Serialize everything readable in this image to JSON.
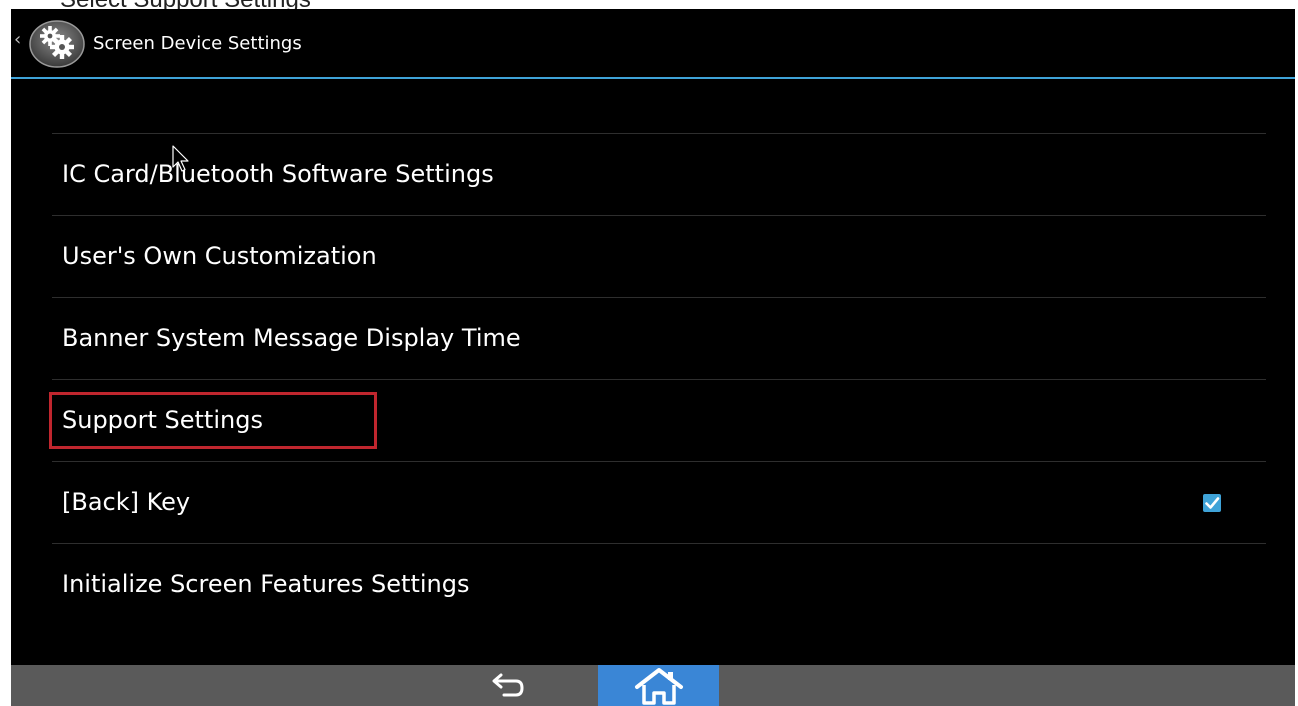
{
  "caption": {
    "text": "Select Support Settings"
  },
  "header": {
    "title": "Screen Device Settings",
    "back_chevron": "‹",
    "accent_color": "#3fa3d8",
    "icon": "gear-settings-icon"
  },
  "settings_list": {
    "items": [
      {
        "label": "IC Card/Bluetooth Software Settings",
        "checked": null
      },
      {
        "label": "User's Own Customization",
        "checked": null
      },
      {
        "label": "Banner System Message Display Time",
        "checked": null
      },
      {
        "label": "Support Settings",
        "checked": null,
        "highlighted": true
      },
      {
        "label": "[Back] Key",
        "checked": true
      },
      {
        "label": "Initialize Screen Features Settings",
        "checked": null
      }
    ],
    "highlight_color": "#c0262e",
    "checkbox_color": "#3fa3d8"
  },
  "navbar": {
    "back_icon": "undo-arrow-icon",
    "home_icon": "home-icon",
    "home_active_color": "#3a86d6"
  }
}
